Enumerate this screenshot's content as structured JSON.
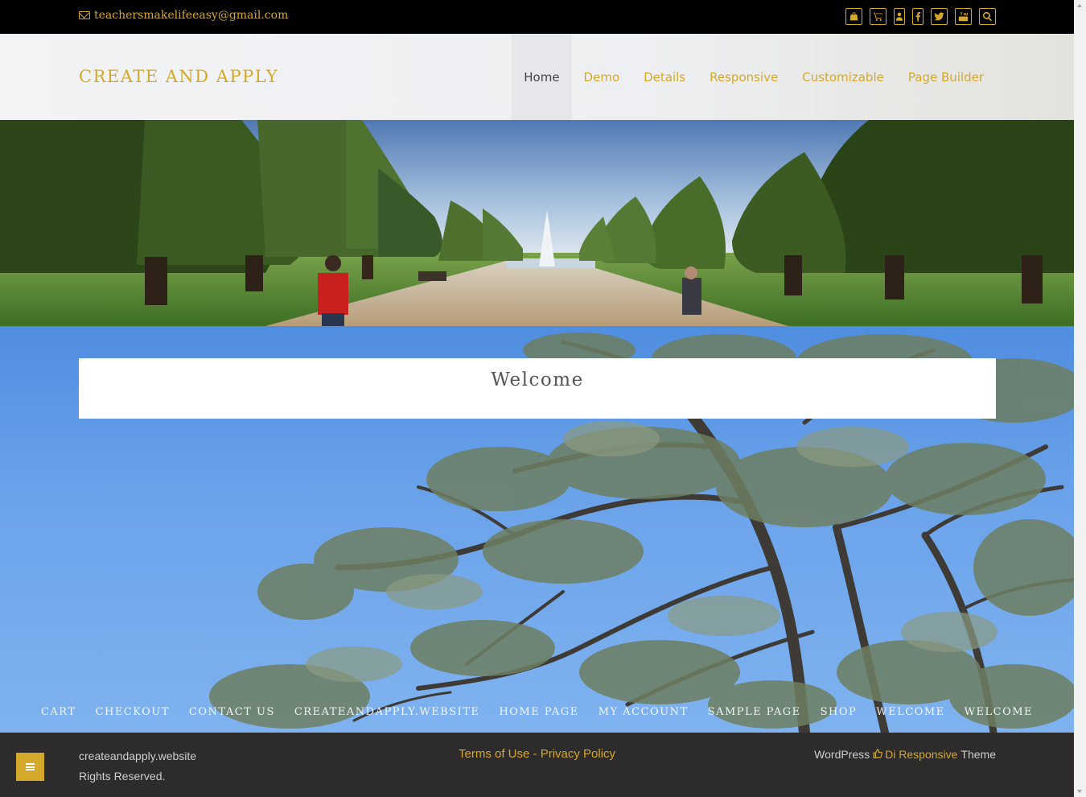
{
  "topbar": {
    "email": "teachersmakelifeeasy@gmail.com",
    "social_icons": [
      "shopping-bag-icon",
      "cart-icon",
      "user-icon",
      "facebook-icon",
      "twitter-icon",
      "youtube-icon",
      "search-icon"
    ]
  },
  "header": {
    "site_title": "CREATE AND APPLY",
    "nav": [
      {
        "label": "Home",
        "active": true
      },
      {
        "label": "Demo"
      },
      {
        "label": "Details"
      },
      {
        "label": "Responsive"
      },
      {
        "label": "Customizable"
      },
      {
        "label": "Page Builder"
      }
    ]
  },
  "main": {
    "welcome_title": "Welcome"
  },
  "footer_menu": [
    "CART",
    "CHECKOUT",
    "CONTACT US",
    "CREATEANDAPPLY.WEBSITE",
    "HOME PAGE",
    "MY ACCOUNT",
    "SAMPLE PAGE",
    "SHOP",
    "WELCOME",
    "WELCOME"
  ],
  "footer": {
    "copyright_line1": "createandapply.website",
    "copyright_line2": "Rights Reserved.",
    "terms_label": "Terms of Use",
    "separator": " - ",
    "privacy_label": "Privacy Policy",
    "credit_prefix": "WordPress",
    "credit_theme": "Di Responsive",
    "credit_suffix": "Theme"
  },
  "colors": {
    "accent": "#d4a92a",
    "topbar_bg": "#000000",
    "footer_bg": "#2d2b2b"
  }
}
